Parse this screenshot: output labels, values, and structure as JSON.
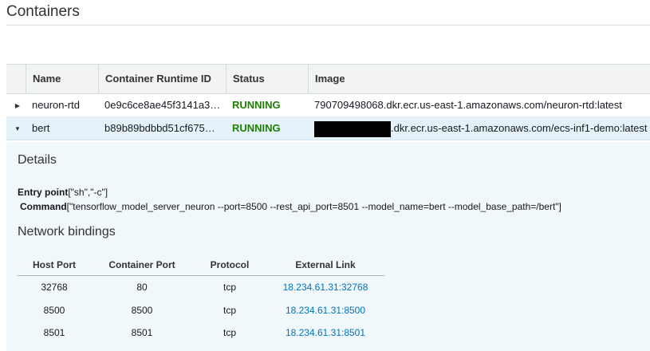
{
  "page": {
    "title": "Containers"
  },
  "table": {
    "columns": [
      "Name",
      "Container Runtime ID",
      "Status",
      "Image"
    ],
    "rows": [
      {
        "name": "neuron-rtd",
        "runtime_id": "0e9c6ce8ae45f3141a3…",
        "status": "RUNNING",
        "image": "790709498068.dkr.ecr.us-east-1.amazonaws.com/neuron-rtd:latest",
        "expanded": false
      },
      {
        "name": "bert",
        "runtime_id": "b89b89bdbbd51cf675…",
        "status": "RUNNING",
        "image": ".dkr.ecr.us-east-1.amazonaws.com/ecs-inf1-demo:latest",
        "expanded": true
      }
    ]
  },
  "details": {
    "title": "Details",
    "entry_point_label": "Entry point",
    "entry_point_value": "[\"sh\",\"-c\"]",
    "command_label": "Command",
    "command_value": "[\"tensorflow_model_server_neuron --port=8500 --rest_api_port=8501 --model_name=bert --model_base_path=/bert\"]"
  },
  "network": {
    "title": "Network bindings",
    "columns": [
      "Host Port",
      "Container Port",
      "Protocol",
      "External Link"
    ],
    "rows": [
      {
        "host_port": "32768",
        "container_port": "80",
        "protocol": "tcp",
        "external_link": "18.234.61.31:32768"
      },
      {
        "host_port": "8500",
        "container_port": "8500",
        "protocol": "tcp",
        "external_link": "18.234.61.31:8500"
      },
      {
        "host_port": "8501",
        "container_port": "8501",
        "protocol": "tcp",
        "external_link": "18.234.61.31:8501"
      }
    ]
  },
  "colors": {
    "status_running": "#1d8102",
    "link": "#0073bb",
    "selected_row": "#e6f2fa",
    "details_bg": "#f1f8fc"
  },
  "icons": {
    "collapsed": "caret-right-icon",
    "expanded": "caret-down-icon"
  }
}
